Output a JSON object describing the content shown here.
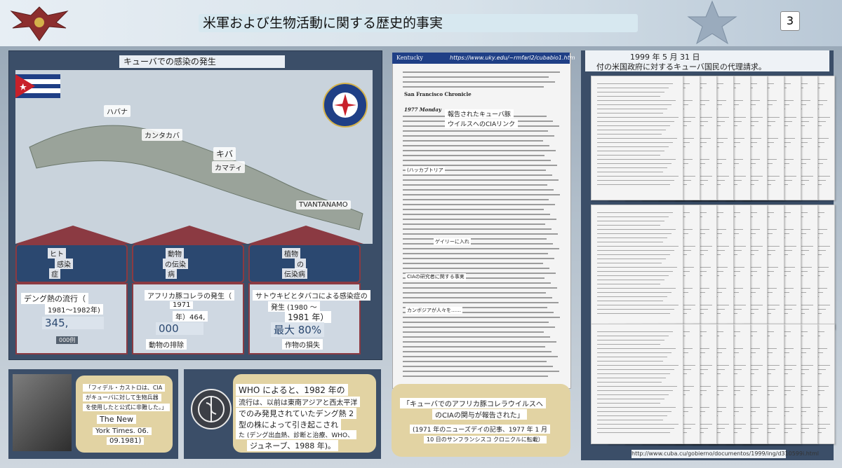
{
  "header": {
    "title": "米軍および生物活動に関する歴史的事実",
    "page_number": "3"
  },
  "left": {
    "heading": "キューバでの感染の発生",
    "map_labels": [
      "ハバナ",
      "カンタカバ",
      "キバ",
      "カマティ",
      "TVANTANAMO"
    ],
    "categories": [
      {
        "lines": [
          "ヒト",
          "感染",
          "症"
        ]
      },
      {
        "lines": [
          "動物",
          "の伝染",
          "病"
        ]
      },
      {
        "lines": [
          "植物",
          "の",
          "伝染病"
        ]
      }
    ],
    "boxes": [
      {
        "title": "デング熱の流行（",
        "sub": "1981〜1982年)",
        "big": "345,",
        "tag": "000例"
      },
      {
        "title": "アフリカ豚コレラの発生（",
        "sub1": "1971",
        "sub2": "年）464,",
        "big": "000",
        "tag": "動物の排除"
      },
      {
        "title": "サトウキビとタバコによる感染症の",
        "sub1": "発生 (1980 〜",
        "sub2": "1981 年）",
        "big": "最大 80%",
        "tag": "作物の損失"
      }
    ]
  },
  "castro": {
    "lines": [
      "「フィデル・カストロは、CIA",
      "がキューバに対して生物兵器",
      "を使用したと公式に非難した。」",
      "The New",
      "York Times. 06.",
      "09.1981)"
    ]
  },
  "who": {
    "lines": [
      "WHO によると、1982 年の",
      "流行は、以前は東南アジアと西太平洋",
      "でのみ発見されていたデング熱 2",
      "型の株によって引き起こされ",
      "た (デング出血熱、診断と治療、WHO、",
      "ジュネーブ、1988 年)。"
    ]
  },
  "doc": {
    "header_url": "https://www.uky.edu/~rmfarl2/cubabio1.htm",
    "brand": "Kentucky",
    "paper": "San Francisco Chronicle",
    "date": "1977 Monday",
    "callouts": [
      "報告されたキューバ豚",
      "ウイルスへのCIAリンク",
      "(ハッカブトリア",
      "ゲイリーに入れ",
      "CIAの研究者に関する事実",
      "カンボジアが人々を……"
    ]
  },
  "middle_bubble": {
    "lines": [
      "「キューバでのアフリカ豚コレラウイルスへ",
      "のCIAの関与が報告された」",
      "(1971 年のニューズデイの記事、1977 年 1 月",
      "10 日のサンフランシスコ クロニクルに転載）"
    ]
  },
  "right": {
    "heading_date": "1999 年 5 月 31 日",
    "heading_text": "付の米国政府に対するキューバ国民の代理請求。",
    "url": "http://www.cuba.cu/gobierno/documentos/1999/ing/d310599i.html"
  }
}
